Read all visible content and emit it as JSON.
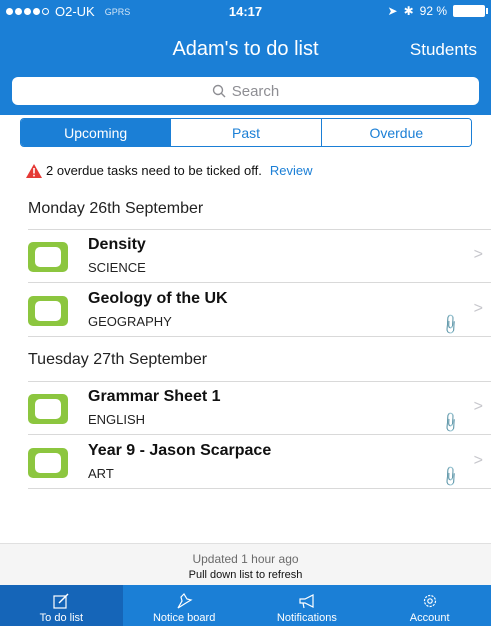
{
  "status_bar": {
    "carrier": "O2-UK",
    "network": "GPRS",
    "time": "14:17",
    "battery": "92 %"
  },
  "nav": {
    "title": "Adam's to do list",
    "right_label": "Students"
  },
  "search": {
    "placeholder": "Search"
  },
  "segments": [
    {
      "label": "Upcoming",
      "active": true
    },
    {
      "label": "Past",
      "active": false
    },
    {
      "label": "Overdue",
      "active": false
    }
  ],
  "overdue_notice": {
    "text": "2 overdue tasks need to be ticked off.",
    "link": "Review"
  },
  "sections": [
    {
      "header": "Monday 26th September",
      "tasks": [
        {
          "title": "Density",
          "subject": "SCIENCE",
          "attachment": false
        },
        {
          "title": "Geology of the UK",
          "subject": "GEOGRAPHY",
          "attachment": true
        }
      ]
    },
    {
      "header": "Tuesday 27th September",
      "tasks": [
        {
          "title": "Grammar Sheet 1",
          "subject": "ENGLISH",
          "attachment": true
        },
        {
          "title": "Year 9 - Jason Scarpace",
          "subject": "ART",
          "attachment": true
        }
      ]
    }
  ],
  "footer": {
    "updated": "Updated 1 hour ago",
    "pull_hint": "Pull down list to refresh"
  },
  "tabs": [
    {
      "label": "To do list",
      "icon": "pencil-square-icon",
      "active": true
    },
    {
      "label": "Notice board",
      "icon": "pin-icon",
      "active": false
    },
    {
      "label": "Notifications",
      "icon": "megaphone-icon",
      "active": false
    },
    {
      "label": "Account",
      "icon": "gear-icon",
      "active": false
    }
  ],
  "colors": {
    "accent": "#1b7fd6",
    "checkbox": "#8cc63f",
    "warning": "#e53935"
  }
}
